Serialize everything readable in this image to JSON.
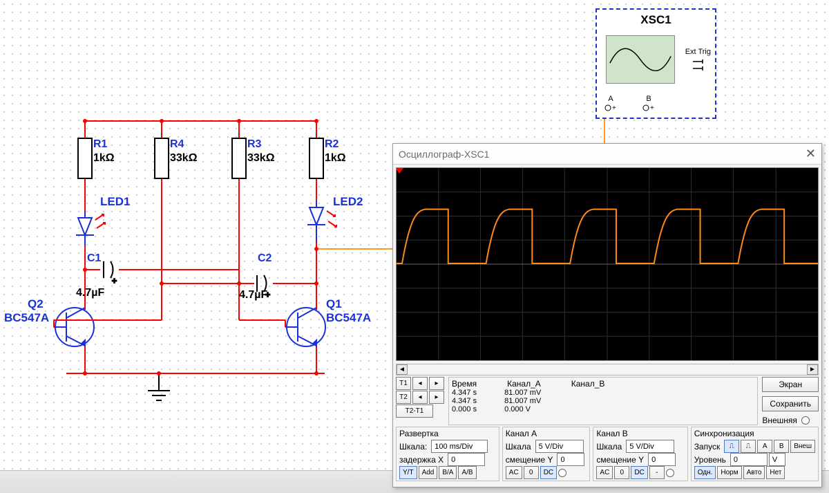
{
  "instrument": {
    "name": "XSC1",
    "ext_trig": "Ext Trig",
    "port_a": "A",
    "port_b": "B"
  },
  "schematic": {
    "R1": {
      "ref": "R1",
      "val": "1kΩ"
    },
    "R4": {
      "ref": "R4",
      "val": "33kΩ"
    },
    "R3": {
      "ref": "R3",
      "val": "33kΩ"
    },
    "R2": {
      "ref": "R2",
      "val": "1kΩ"
    },
    "LED1": "LED1",
    "LED2": "LED2",
    "C1": {
      "ref": "C1",
      "val": "4.7µF"
    },
    "C2": {
      "ref": "C2",
      "val": "4.7µF"
    },
    "Q2": {
      "ref": "Q2",
      "model": "BC547A"
    },
    "Q1": {
      "ref": "Q1",
      "model": "BC547A"
    }
  },
  "oscilloscope": {
    "title": "Осциллограф-XSC1",
    "cursor": {
      "header_time": "Время",
      "header_ca": "Канал_A",
      "header_cb": "Канал_B",
      "T1_label": "T1",
      "T2_label": "T2",
      "TdT_label": "T2-T1",
      "T1_time": "4.347 s",
      "T1_ca": "81.007 mV",
      "T2_time": "4.347 s",
      "T2_ca": "81.007 mV",
      "TdT_time": "0.000 s",
      "TdT_ca": "0.000 V"
    },
    "buttons": {
      "screen": "Экран",
      "save": "Сохранить",
      "external": "Внешняя"
    },
    "timebase": {
      "title": "Развертка",
      "scale_label": "Шкала:",
      "scale": "100 ms/Div",
      "xdelay_label": "задержка X",
      "xdelay": "0",
      "yt": "Y/T",
      "add": "Add",
      "ba": "B/A",
      "ab": "A/B"
    },
    "channel_a": {
      "title": "Канал A",
      "scale_label": "Шкала",
      "scale": "5  V/Div",
      "yoff_label": "смещение Y",
      "yoff": "0",
      "ac": "AC",
      "zero": "0",
      "dc": "DC"
    },
    "channel_b": {
      "title": "Канал B",
      "scale_label": "Шкала",
      "scale": "5  V/Div",
      "yoff_label": "смещение Y",
      "yoff": "0",
      "ac": "AC",
      "zero": "0",
      "dc": "DC",
      "minus": "-"
    },
    "trigger": {
      "title": "Синхронизация",
      "launch": "Запуск",
      "a": "A",
      "b": "B",
      "ext": "Внеш",
      "level_label": "Уровень",
      "level": "0",
      "level_unit": "V",
      "single": "Одн.",
      "normal": "Норм",
      "auto": "Авто",
      "none": "Нет"
    }
  }
}
